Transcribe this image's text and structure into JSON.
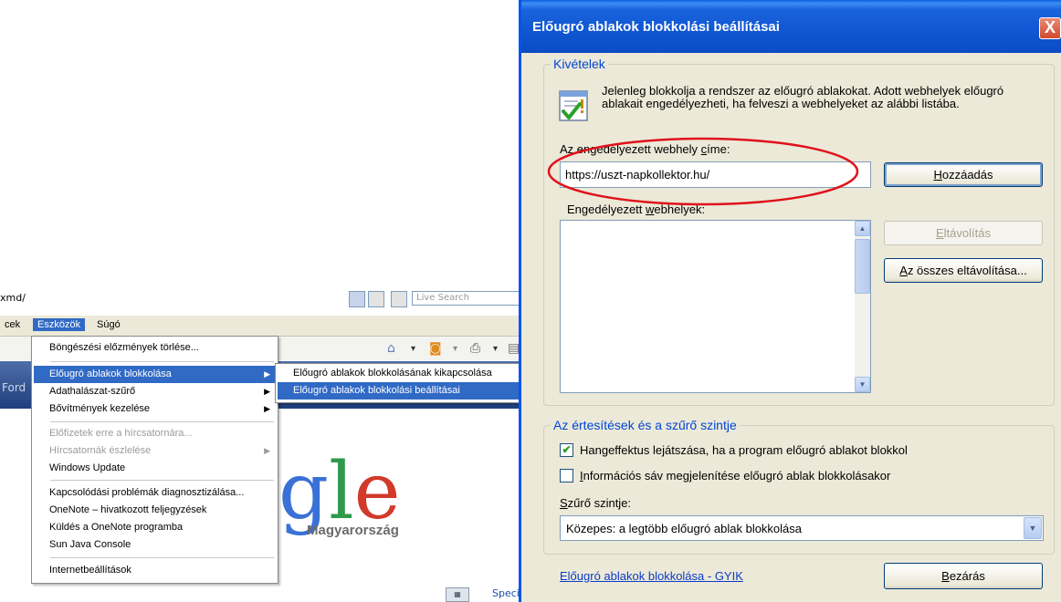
{
  "browser": {
    "address_fragment": "xmd/",
    "search_placeholder": "Live Search",
    "menubar": [
      "cek",
      "Eszközök",
      "Súgó"
    ],
    "strip_text": "Ford",
    "logo_suffix": "Magyarország",
    "special_link": "Speciá"
  },
  "tools_menu": {
    "items": [
      {
        "label": "Böngészési előzmények törlése..."
      },
      {
        "label": "Előugró ablakok blokkolása"
      },
      {
        "label": "Adathalászat-szűrő"
      },
      {
        "label": "Bővítmények kezelése"
      },
      {
        "label": "Előfizetek erre a hírcsatornára..."
      },
      {
        "label": "Hírcsatornák észlelése"
      },
      {
        "label": "Windows Update"
      },
      {
        "label": "Kapcsolódási problémák diagnosztizálása..."
      },
      {
        "label": "OneNote – hivatkozott feljegyzések"
      },
      {
        "label": "Küldés a OneNote programba"
      },
      {
        "label": "Sun Java Console"
      },
      {
        "label": "Internetbeállítások"
      }
    ]
  },
  "popup_submenu": {
    "items": [
      {
        "label": "Előugró ablakok blokkolásának kikapcsolása"
      },
      {
        "label": "Előugró ablakok blokkolási beállításai"
      }
    ]
  },
  "dialog": {
    "title": "Előugró ablakok blokkolási beállításai",
    "close_label": "X",
    "exceptions_legend": "Kivételek",
    "info_text": "Jelenleg blokkolja a rendszer az előugró ablakokat. Adott webhelyek előugró ablakait engedélyezheti, ha felveszi a webhelyeket az alábbi listába.",
    "address_label_pre": "Az engedélyezett webhely ",
    "address_label_key": "c",
    "address_label_post": "íme:",
    "address_value": "https://uszt-napkollektor.hu/",
    "add_button_key": "H",
    "add_button_rest": "ozzáadás",
    "allowed_label_pre": "Engedélyezett ",
    "allowed_label_key": "w",
    "allowed_label_post": "ebhelyek:",
    "remove_key": "E",
    "remove_rest": "ltávolítás",
    "remove_all_key": "A",
    "remove_all_rest": "z összes eltávolítása...",
    "notify_legend": "Az értesítések és a szűrő szintje",
    "sound_checkbox_label": "Hangeffektus lejátszása, ha a program előugró ablakot blokkol",
    "sound_checked": true,
    "infobar_key": "I",
    "infobar_rest": "nformációs sáv megjelenítése előugró ablak blokkolásakor",
    "infobar_checked": false,
    "filter_key": "S",
    "filter_rest": "zűrő szintje:",
    "filter_value": "Közepes: a legtöbb előugró ablak blokkolása",
    "faq_link": "Előugró ablakok blokkolása - GYIK",
    "close_key": "B",
    "close_rest": "ezárás"
  },
  "colors": {
    "title_blue": "#0f56d2",
    "menu_highlight": "#316ac5",
    "legend_blue": "#0046d5",
    "annotation_red": "#e0121b",
    "dialog_bg": "#ece9d8"
  }
}
